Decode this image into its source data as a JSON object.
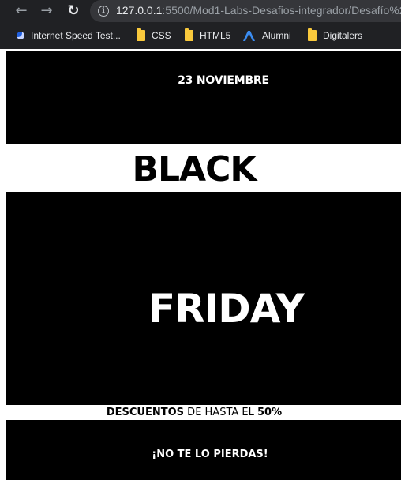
{
  "browser": {
    "url_host": "127.0.0.1",
    "url_path": ":5500/Mod1-Labs-Desafios-integrador/Desafío%2",
    "nav_back_icon": "arrow-left-icon",
    "nav_forward_icon": "arrow-right-icon",
    "reload_icon": "reload-icon",
    "info_icon": "info-icon"
  },
  "bookmarks": [
    {
      "label": "Internet Speed Test...",
      "icon": "speedtest-icon"
    },
    {
      "label": "CSS",
      "icon": "folder-icon"
    },
    {
      "label": "HTML5",
      "icon": "folder-icon"
    },
    {
      "label": "Alumni",
      "icon": "alumni-logo-icon"
    },
    {
      "label": "Digitalers",
      "icon": "folder-icon"
    }
  ],
  "page": {
    "date": "23 NOVIEMBRE",
    "title_black": "BLACK",
    "title_friday": "FRIDAY",
    "discount": {
      "prefix_bold": "DESCUENTOS",
      "middle": " DE HASTA EL ",
      "suffix_bold": "50%"
    },
    "cta": "¡NO TE LO PIERDAS!"
  },
  "colors": {
    "chrome_bg": "#202124",
    "omnibox_bg": "#35363a",
    "band_bg": "#000000",
    "page_bg": "#ffffff",
    "folder": "#f9c93c"
  }
}
